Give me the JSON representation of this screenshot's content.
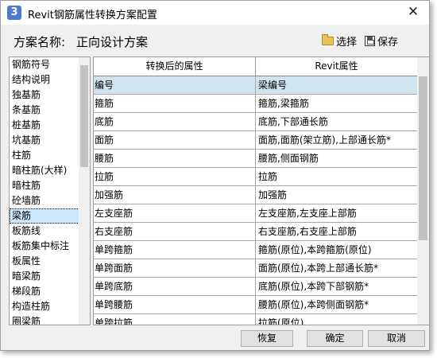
{
  "window": {
    "app_icon_text": "3",
    "title": "Revit钢筋属性转换方案配置",
    "close_glyph": "✕"
  },
  "scheme": {
    "label": "方案名称:",
    "value": "正向设计方案",
    "select_label": "选择",
    "save_label": "保存"
  },
  "categories": [
    "钢筋符号",
    "结构说明",
    "独基筋",
    "条基筋",
    "桩基筋",
    "坑基筋",
    "柱筋",
    "暗柱筋(大样)",
    "暗柱筋",
    "砼墙筋",
    "梁筋",
    "板筋线",
    "板筋集中标注",
    "板属性",
    "暗梁筋",
    "梯段筋",
    "构造柱筋",
    "圈梁筋"
  ],
  "selected_category": "梁筋",
  "grid": {
    "columns": [
      "转换后的属性",
      "Revit属性"
    ],
    "rows": [
      [
        "编号",
        "梁编号"
      ],
      [
        "箍筋",
        "箍筋,梁箍筋"
      ],
      [
        "底筋",
        "底筋,下部通长筋"
      ],
      [
        "面筋",
        "面筋,面筋(架立筋),上部通长筋*"
      ],
      [
        "腰筋",
        "腰筋,侧面钢筋"
      ],
      [
        "拉筋",
        "拉筋"
      ],
      [
        "加强筋",
        "加强筋"
      ],
      [
        "左支座筋",
        "左支座筋,左支座上部筋"
      ],
      [
        "右支座筋",
        "右支座筋,右支座上部筋"
      ],
      [
        "单跨箍筋",
        "箍筋(原位),本跨箍筋(原位)"
      ],
      [
        "单跨面筋",
        "面筋(原位),本跨上部通长筋*"
      ],
      [
        "单跨底筋",
        "底筋(原位),本跨下部钢筋*"
      ],
      [
        "单跨腰筋",
        "腰筋(原位),本跨侧面钢筋*"
      ],
      [
        "单跨拉筋",
        "拉筋(原位)"
      ]
    ]
  },
  "buttons": {
    "restore": "恢复",
    "ok": "确定",
    "cancel": "取消"
  }
}
